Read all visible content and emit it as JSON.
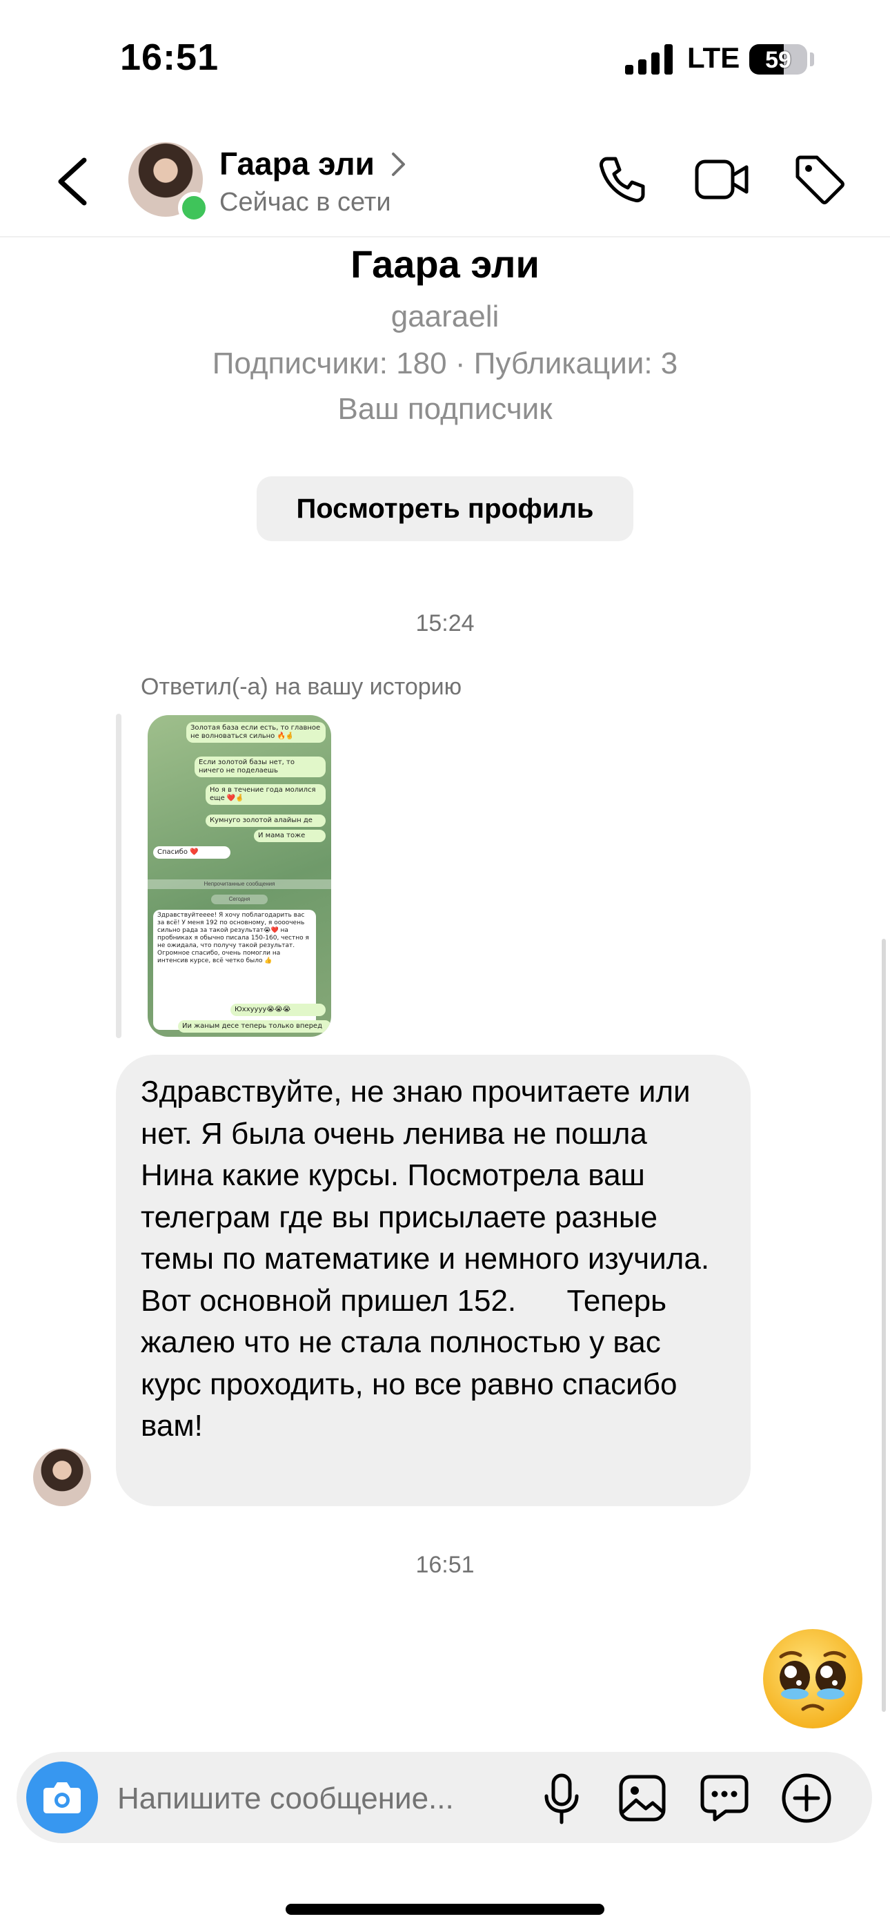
{
  "status_bar": {
    "time": "16:51",
    "network": "LTE",
    "battery": "59",
    "battery_level": 0.59
  },
  "header": {
    "contact_name": "Гаара эли",
    "status": "Сейчас в сети",
    "online_color": "#3fc45a"
  },
  "profile": {
    "name": "Гаара эли",
    "username": "gaaraeli",
    "stats": "Подписчики: 180 · Публикации: 3",
    "relationship": "Ваш подписчик",
    "view_button": "Посмотреть профиль"
  },
  "thread": {
    "timestamp_1": "15:24",
    "story_reply_label": "Ответил(-а) на вашу историю",
    "story_screenshot": {
      "messages": [
        {
          "dir": "out",
          "text": "Золотая база если есть, то главное не волноваться сильно 🔥🤞"
        },
        {
          "dir": "out",
          "text": "Если золотой базы нет, то ничего не поделаешь"
        },
        {
          "dir": "out",
          "text": "Но я в течение года молился еще ❤️🤞"
        },
        {
          "dir": "out",
          "text": "Кумнуго золотой алайын де"
        },
        {
          "dir": "out",
          "text": "И мама тоже"
        },
        {
          "dir": "in",
          "text": "Спасибо ❤️"
        },
        {
          "dir": "sep",
          "text": "Непрочитанные сообщения"
        },
        {
          "dir": "sep",
          "text": "Сегодня"
        },
        {
          "dir": "in",
          "text": "Здравствуйтееее! Я хочу поблагодарить вас за всё! У меня 192 по основному, я оооочень сильно рада за такой результат😭❤️ на пробниках я обычно писала 150-160, честно я не ожидала, что получу такой результат. Огромное спасибо, очень помогли на интенсив курсе, всё четко было 👍"
        },
        {
          "dir": "out",
          "text": "Юххуууу😭😭😭"
        },
        {
          "dir": "out",
          "text": "Ии жаным десе теперь только вперед"
        }
      ]
    },
    "message_text": "Здравствуйте, не знаю прочитаете или нет. Я была очень ленива не пошла Нина какие курсы. Посмотрела ваш телеграм где вы присылаете разные темы по математике и немного изучила. Вот основной пришел 152.      Теперь жалею что не стала полностью у вас курс проходить, но все равно спасибо вам!",
    "timestamp_2": "16:51",
    "reaction_emoji": "🥹"
  },
  "composer": {
    "placeholder": "Напишите сообщение...",
    "accent_color": "#3797f0"
  },
  "icons": {
    "back": "chevron-left-icon",
    "phone": "phone-icon",
    "video": "video-camera-icon",
    "tag": "tag-icon",
    "camera": "camera-icon",
    "mic": "microphone-icon",
    "gallery": "image-icon",
    "sticker": "sticker-chat-icon",
    "plus": "plus-circle-icon"
  }
}
